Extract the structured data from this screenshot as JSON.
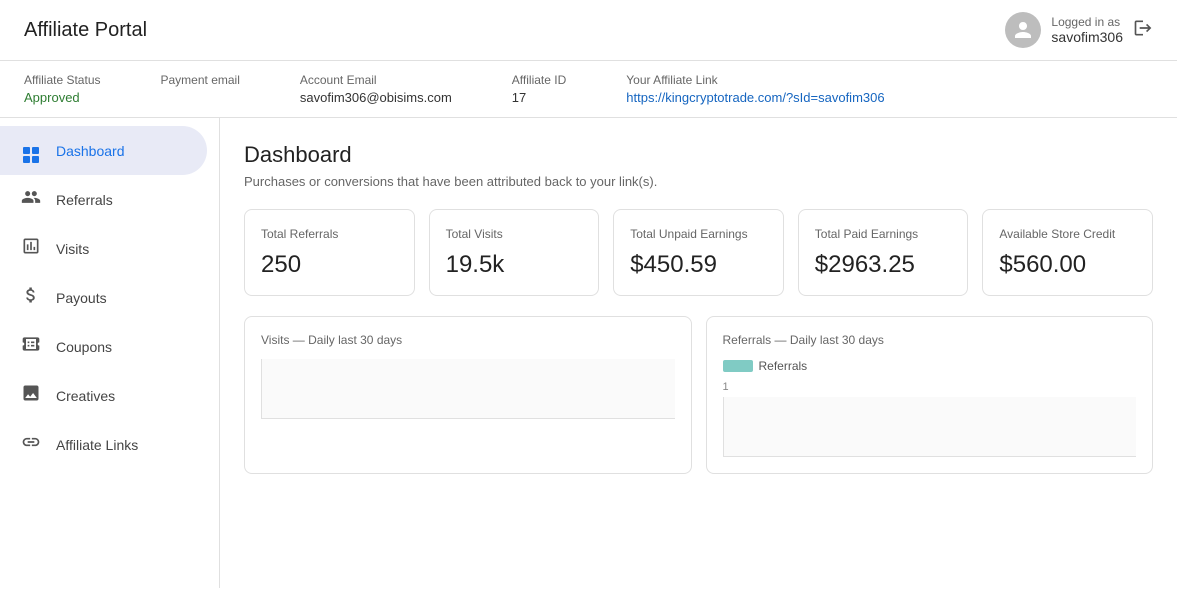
{
  "header": {
    "title": "Affiliate Portal",
    "logged_in_label": "Logged in as",
    "username": "savofim306",
    "logout_icon": "→"
  },
  "info_bar": {
    "affiliate_status_label": "Affiliate Status",
    "affiliate_status_value": "Approved",
    "payment_email_label": "Payment email",
    "account_email_label": "Account Email",
    "account_email_value": "savofim306@obisims.com",
    "affiliate_id_label": "Affiliate ID",
    "affiliate_id_value": "17",
    "affiliate_link_label": "Your Affiliate Link",
    "affiliate_link_value": "https://kingcryptotrade.com/?sId=savofim306"
  },
  "sidebar": {
    "items": [
      {
        "id": "dashboard",
        "label": "Dashboard",
        "active": true
      },
      {
        "id": "referrals",
        "label": "Referrals",
        "active": false
      },
      {
        "id": "visits",
        "label": "Visits",
        "active": false
      },
      {
        "id": "payouts",
        "label": "Payouts",
        "active": false
      },
      {
        "id": "coupons",
        "label": "Coupons",
        "active": false
      },
      {
        "id": "creatives",
        "label": "Creatives",
        "active": false
      },
      {
        "id": "affiliate-links",
        "label": "Affiliate Links",
        "active": false
      }
    ]
  },
  "dashboard": {
    "title": "Dashboard",
    "subtitle": "Purchases or conversions that have been attributed back to your link(s).",
    "stats": [
      {
        "label": "Total Referrals",
        "value": "250"
      },
      {
        "label": "Total Visits",
        "value": "19.5k"
      },
      {
        "label": "Total Unpaid Earnings",
        "value": "$450.59"
      },
      {
        "label": "Total Paid Earnings",
        "value": "$2963.25"
      },
      {
        "label": "Available Store Credit",
        "value": "$560.00"
      }
    ],
    "charts": [
      {
        "title": "Visits — Daily last 30 days",
        "legend": null
      },
      {
        "title": "Referrals — Daily last 30 days",
        "legend": "Referrals"
      }
    ],
    "chart_y_value": "1",
    "legend_color": "#80cbc4"
  }
}
